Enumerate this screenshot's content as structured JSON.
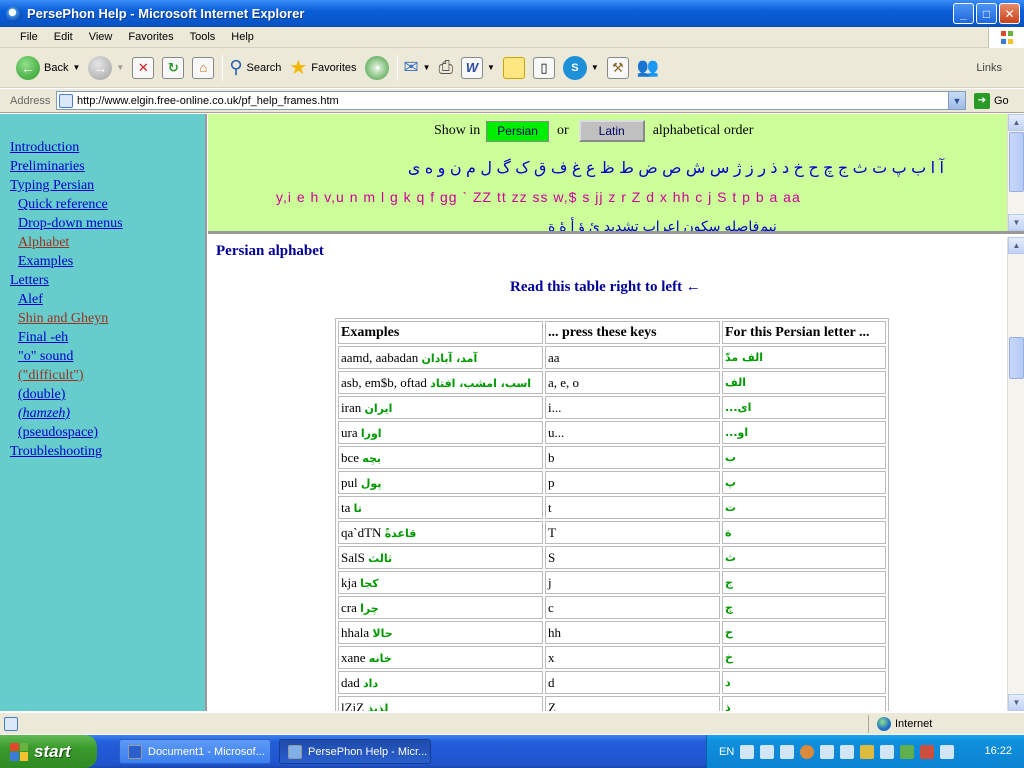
{
  "window": {
    "title": "PersePhon Help - Microsoft Internet Explorer",
    "min": "_",
    "max": "□",
    "close": "✕"
  },
  "menu": [
    "File",
    "Edit",
    "View",
    "Favorites",
    "Tools",
    "Help"
  ],
  "toolbar": {
    "back": "Back",
    "search": "Search",
    "favorites": "Favorites",
    "links": "Links"
  },
  "address": {
    "label": "Address",
    "url": "http://www.elgin.free-online.co.uk/pf_help_frames.htm",
    "go": "Go"
  },
  "nav": [
    {
      "label": "Introduction",
      "sub": false,
      "visited": false
    },
    {
      "label": "Preliminaries",
      "sub": false,
      "visited": false
    },
    {
      "label": "Typing Persian",
      "sub": false,
      "visited": false
    },
    {
      "label": "Quick reference",
      "sub": true,
      "visited": false
    },
    {
      "label": "Drop-down menus",
      "sub": true,
      "visited": false
    },
    {
      "label": "Alphabet",
      "sub": true,
      "visited": true
    },
    {
      "label": "Examples",
      "sub": true,
      "visited": false
    },
    {
      "label": "Letters",
      "sub": false,
      "visited": false
    },
    {
      "label": "Alef",
      "sub": true,
      "visited": false
    },
    {
      "label": "Shin and Gheyn",
      "sub": true,
      "visited": true
    },
    {
      "label": "Final -eh",
      "sub": true,
      "visited": false
    },
    {
      "label": "\"o\" sound",
      "sub": true,
      "visited": false
    },
    {
      "label": "(\"difficult\")",
      "sub": true,
      "visited": true
    },
    {
      "label": "(double)",
      "sub": true,
      "visited": false
    },
    {
      "label": "(hamzeh)",
      "sub": true,
      "visited": false,
      "italic": true
    },
    {
      "label": "(pseudospace)",
      "sub": true,
      "visited": false
    },
    {
      "label": "Troubleshooting",
      "sub": false,
      "visited": false
    }
  ],
  "topframe": {
    "show_in": "Show in",
    "persian_btn": "Persian",
    "or": "or",
    "latin_btn": "Latin",
    "order": "alphabetical order",
    "persian_letters": "آ ا ب پ ت ث ج چ ح خ د ذ ر ز ژ س ش ص ض ط ظ ع غ ف ق ک گ ل م ن و ه ی",
    "latin_keys": "y,i e h v,u n m l g k q f gg ` ZZ tt zz ss w,$ s jj z r Z d x hh c j S t p b a aa",
    "diacritics": "نیم‌فاصله سکون اعراب تشدید ئ ؤ أ ۀ ة"
  },
  "main": {
    "heading": "Persian alphabet",
    "rtl_note": "Read this table right to left ←",
    "columns": [
      "Examples",
      "... press these keys",
      "For this Persian letter ..."
    ],
    "rows": [
      {
        "ex": "aamd, aabadan",
        "fa": "آمد، آبادان",
        "keys": "aa",
        "letter": "الف مدّ"
      },
      {
        "ex": "asb, em$b, oftad",
        "fa": "اسب، امشب، افتاد",
        "keys": "a, e, o",
        "letter": "الف"
      },
      {
        "ex": "iran",
        "fa": "ایران",
        "keys": "i...",
        "letter": "ای..."
      },
      {
        "ex": "ura",
        "fa": "اورا",
        "keys": "u...",
        "letter": "او..."
      },
      {
        "ex": "bce",
        "fa": "بچه",
        "keys": "b",
        "letter": "ب"
      },
      {
        "ex": "pul",
        "fa": "پول",
        "keys": "p",
        "letter": "پ"
      },
      {
        "ex": "ta",
        "fa": "تا",
        "keys": "t",
        "letter": "ت"
      },
      {
        "ex": "qa`dTN",
        "fa": "قاعدةً",
        "keys": "T",
        "letter": "ة"
      },
      {
        "ex": "SalS",
        "fa": "ثالث",
        "keys": "S",
        "letter": "ث"
      },
      {
        "ex": "kja",
        "fa": "کجا",
        "keys": "j",
        "letter": "ج"
      },
      {
        "ex": "cra",
        "fa": "چرا",
        "keys": "c",
        "letter": "چ"
      },
      {
        "ex": "hhala",
        "fa": "حالا",
        "keys": "hh",
        "letter": "ح"
      },
      {
        "ex": "xane",
        "fa": "خانه",
        "keys": "x",
        "letter": "خ"
      },
      {
        "ex": "dad",
        "fa": "داد",
        "keys": "d",
        "letter": "د"
      },
      {
        "ex": "lZiZ",
        "fa": "لذیذ",
        "keys": "Z",
        "letter": "ذ"
      }
    ]
  },
  "status": {
    "zone": "Internet"
  },
  "taskbar": {
    "start": "start",
    "tasks": [
      "Document1 - Microsof...",
      "PersePhon Help - Micr..."
    ],
    "lang": "EN",
    "clock": "16:22"
  }
}
